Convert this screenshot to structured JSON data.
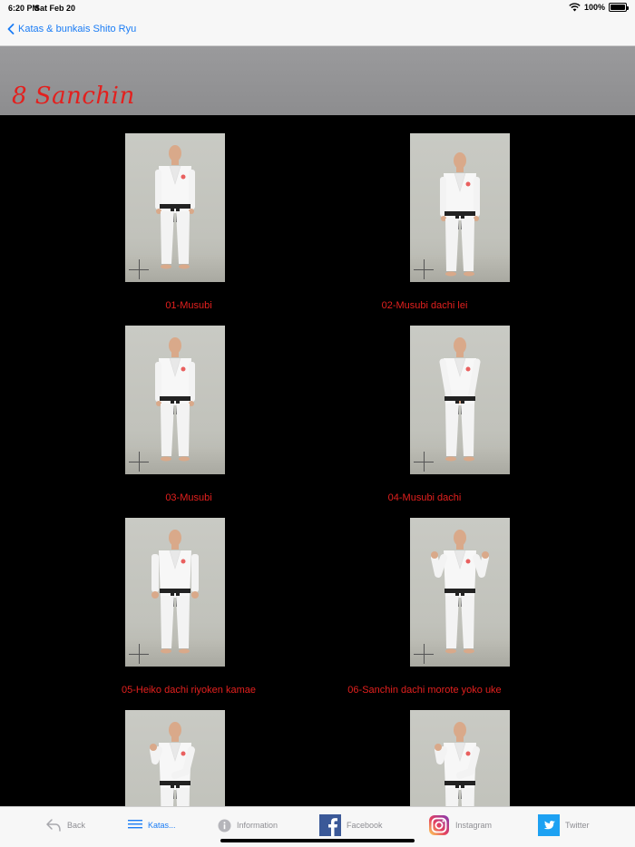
{
  "status": {
    "time": "6:20 PM",
    "date": "Sat Feb 20",
    "battery": "100%"
  },
  "nav": {
    "back_label": "Katas & bunkais Shito Ryu"
  },
  "page": {
    "title": "8 Sanchin"
  },
  "colors": {
    "accent": "#1a7cf5",
    "title_red": "#e3201e",
    "tab_inactive": "#8e8e93"
  },
  "moves": [
    {
      "label": "01-Musubi",
      "pose": "arms-down"
    },
    {
      "label": "02-Musubi dachi lei",
      "pose": "bow"
    },
    {
      "label": "03-Musubi",
      "pose": "arms-down"
    },
    {
      "label": "04-Musubi dachi",
      "pose": "hands-front"
    },
    {
      "label": "05-Heiko dachi riyoken kamae",
      "pose": "fists-side"
    },
    {
      "label": "06-Sanchin dachi morote yoko uke",
      "pose": "arms-up"
    },
    {
      "label": "",
      "pose": "guard"
    },
    {
      "label": "",
      "pose": "guard"
    }
  ],
  "tabs": [
    {
      "label": "Back",
      "icon": "reply-arrow-icon"
    },
    {
      "label": "Katas...",
      "icon": "list-icon"
    },
    {
      "label": "Information",
      "icon": "info-icon"
    },
    {
      "label": "Facebook",
      "icon": "facebook-icon"
    },
    {
      "label": "Instagram",
      "icon": "instagram-icon"
    },
    {
      "label": "Twitter",
      "icon": "twitter-icon"
    }
  ]
}
